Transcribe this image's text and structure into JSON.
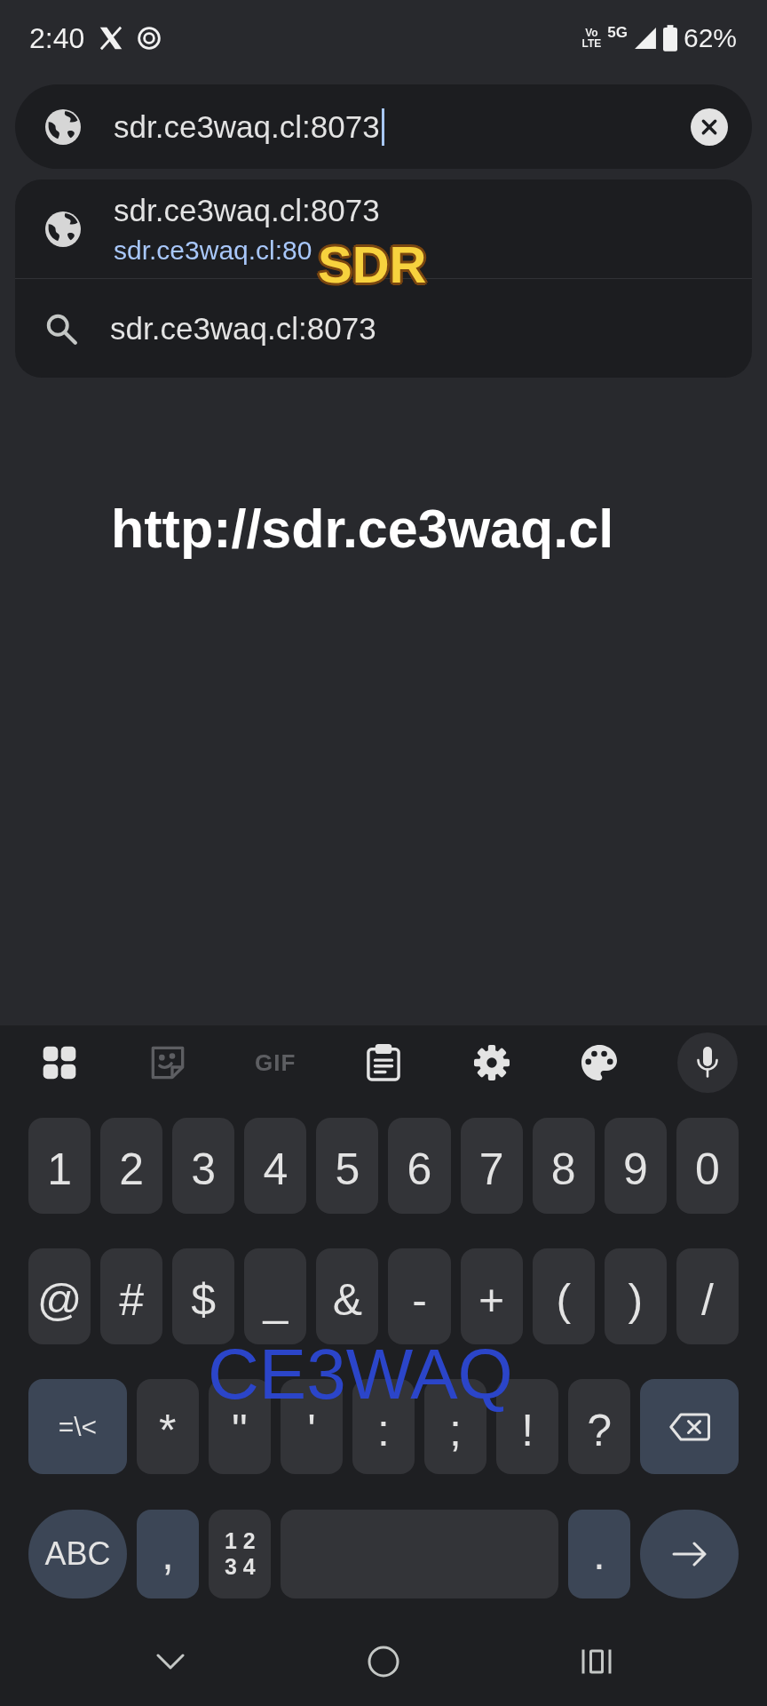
{
  "status_bar": {
    "time": "2:40",
    "network_badge": [
      "Vo",
      "LTE"
    ],
    "network_type": "5G",
    "battery": "62%"
  },
  "address_bar": {
    "value": "sdr.ce3waq.cl:8073"
  },
  "suggestions": [
    {
      "kind": "site",
      "title": "sdr.ce3waq.cl:8073",
      "url": "sdr.ce3waq.cl:80"
    },
    {
      "kind": "search",
      "title": "sdr.ce3waq.cl:8073"
    }
  ],
  "overlay_captions": {
    "url": "http://sdr.ce3waq.cl",
    "tag": "SDR",
    "title": "CE3WAQ"
  },
  "keyboard": {
    "toolbar": [
      {
        "kind": "apps",
        "disabled": false
      },
      {
        "kind": "sticker",
        "disabled": true
      },
      {
        "kind": "gif",
        "label": "GIF",
        "disabled": true
      },
      {
        "kind": "clipboard",
        "disabled": false
      },
      {
        "kind": "settings",
        "disabled": false
      },
      {
        "kind": "theme",
        "disabled": false
      },
      {
        "kind": "mic",
        "disabled": false
      }
    ],
    "rows": [
      [
        {
          "kind": "char",
          "label": "1"
        },
        {
          "kind": "char",
          "label": "2"
        },
        {
          "kind": "char",
          "label": "3"
        },
        {
          "kind": "char",
          "label": "4"
        },
        {
          "kind": "char",
          "label": "5"
        },
        {
          "kind": "char",
          "label": "6"
        },
        {
          "kind": "char",
          "label": "7"
        },
        {
          "kind": "char",
          "label": "8"
        },
        {
          "kind": "char",
          "label": "9"
        },
        {
          "kind": "char",
          "label": "0"
        }
      ],
      [
        {
          "kind": "char",
          "label": "@"
        },
        {
          "kind": "char",
          "label": "#"
        },
        {
          "kind": "char",
          "label": "$"
        },
        {
          "kind": "char",
          "label": "_"
        },
        {
          "kind": "char",
          "label": "&"
        },
        {
          "kind": "char",
          "label": "-"
        },
        {
          "kind": "char",
          "label": "+"
        },
        {
          "kind": "char",
          "label": "("
        },
        {
          "kind": "char",
          "label": ")"
        },
        {
          "kind": "char",
          "label": "/"
        }
      ],
      [
        {
          "kind": "mode",
          "label": "=\\<"
        },
        {
          "kind": "char",
          "label": "*"
        },
        {
          "kind": "char",
          "label": "\""
        },
        {
          "kind": "char",
          "label": "'"
        },
        {
          "kind": "char",
          "label": ":"
        },
        {
          "kind": "char",
          "label": ";"
        },
        {
          "kind": "char",
          "label": "!"
        },
        {
          "kind": "char",
          "label": "?"
        },
        {
          "kind": "backspace"
        }
      ],
      [
        {
          "kind": "mode_round",
          "label": "ABC"
        },
        {
          "kind": "accent",
          "label": ","
        },
        {
          "kind": "numpad",
          "lines": [
            "1 2",
            "3 4"
          ]
        },
        {
          "kind": "space"
        },
        {
          "kind": "accent",
          "label": "."
        },
        {
          "kind": "enter"
        }
      ]
    ]
  }
}
